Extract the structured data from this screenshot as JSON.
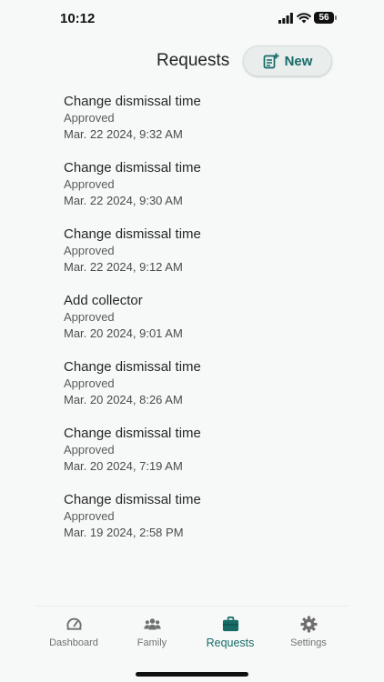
{
  "status_bar": {
    "time": "10:12",
    "battery": "56"
  },
  "header": {
    "title": "Requests",
    "new_label": "New"
  },
  "requests": [
    {
      "title": "Change dismissal time",
      "status": "Approved",
      "date": "Mar. 22 2024, 9:32 AM"
    },
    {
      "title": "Change dismissal time",
      "status": "Approved",
      "date": "Mar. 22 2024, 9:30 AM"
    },
    {
      "title": "Change dismissal time",
      "status": "Approved",
      "date": "Mar. 22 2024, 9:12 AM"
    },
    {
      "title": "Add collector",
      "status": "Approved",
      "date": "Mar. 20 2024, 9:01 AM"
    },
    {
      "title": "Change dismissal time",
      "status": "Approved",
      "date": "Mar. 20 2024, 8:26 AM"
    },
    {
      "title": "Change dismissal time",
      "status": "Approved",
      "date": "Mar. 20 2024, 7:19 AM"
    },
    {
      "title": "Change dismissal time",
      "status": "Approved",
      "date": "Mar. 19 2024, 2:58 PM"
    }
  ],
  "tabs": [
    {
      "label": "Dashboard",
      "icon": "gauge-icon",
      "active": false
    },
    {
      "label": "Family",
      "icon": "people-icon",
      "active": false
    },
    {
      "label": "Requests",
      "icon": "briefcase-icon",
      "active": true
    },
    {
      "label": "Settings",
      "icon": "gear-icon",
      "active": false
    }
  ],
  "colors": {
    "accent": "#166b66",
    "inactive": "#707070",
    "background": "#f7f9f8"
  }
}
